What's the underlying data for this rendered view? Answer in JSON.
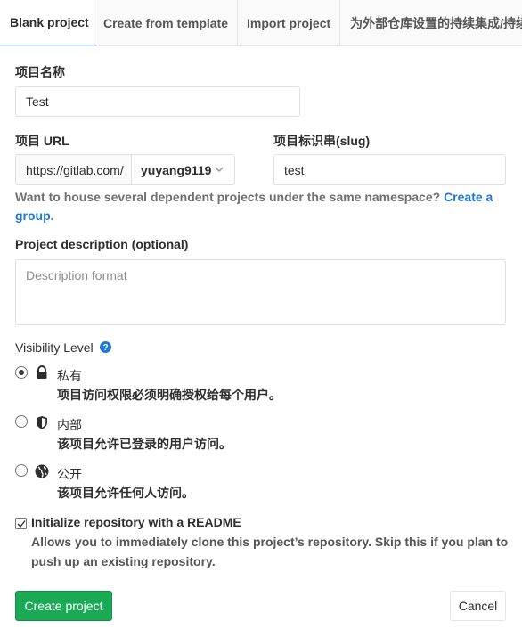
{
  "tabs": [
    {
      "label": "Blank project",
      "active": true
    },
    {
      "label": "Create from template",
      "active": false
    },
    {
      "label": "Import project",
      "active": false
    },
    {
      "label": "为外部仓库设置的持续集成/持续",
      "active": false
    }
  ],
  "project_name": {
    "label": "项目名称",
    "value": "Test"
  },
  "project_url": {
    "label": "项目 URL",
    "prefix": "https://gitlab.com/",
    "namespace": "yuyang9119"
  },
  "project_slug": {
    "label": "项目标识串(slug)",
    "value": "test"
  },
  "namespace_help": {
    "text": "Want to house several dependent projects under the same namespace? ",
    "link": "Create a group",
    "suffix": "."
  },
  "description": {
    "label": "Project description (optional)",
    "placeholder": "Description format"
  },
  "visibility": {
    "label": "Visibility Level",
    "help_icon": "question-circle-icon",
    "options": [
      {
        "title": "私有",
        "description": "项目访问权限必须明确授权给每个用户。",
        "icon": "lock-icon",
        "checked": true
      },
      {
        "title": "内部",
        "description": "该项目允许已登录的用户访问。",
        "icon": "shield-icon",
        "checked": false
      },
      {
        "title": "公开",
        "description": "该项目允许任何人访问。",
        "icon": "earth-icon",
        "checked": false
      }
    ]
  },
  "readme": {
    "label": "Initialize repository with a README",
    "help": "Allows you to immediately clone this project’s repository. Skip this if you plan to push up an existing repository.",
    "checked": true
  },
  "actions": {
    "create": "Create project",
    "cancel": "Cancel"
  },
  "colors": {
    "accent": "#1f78d1",
    "success": "#1aaa55"
  }
}
